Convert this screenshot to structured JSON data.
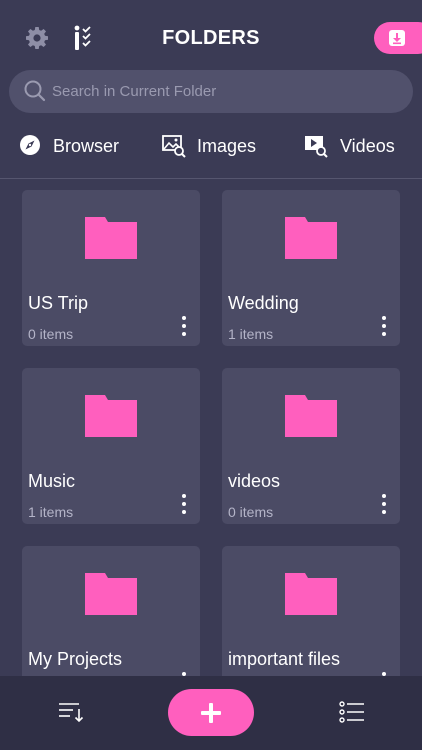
{
  "header": {
    "title": "FOLDERS",
    "settings_icon": "gear-icon",
    "tasks_icon": "task-list-icon",
    "download_icon": "download-icon"
  },
  "search": {
    "placeholder": "Search in Current Folder",
    "value": ""
  },
  "tabs": [
    {
      "label": "Browser",
      "icon": "compass-icon"
    },
    {
      "label": "Images",
      "icon": "image-search-icon"
    },
    {
      "label": "Videos",
      "icon": "video-search-icon"
    }
  ],
  "folders": [
    {
      "name": "US Trip",
      "count": "0 items"
    },
    {
      "name": "Wedding",
      "count": "1 items"
    },
    {
      "name": "Music",
      "count": "1 items"
    },
    {
      "name": "videos",
      "count": "0 items"
    },
    {
      "name": "My Projects",
      "count": ""
    },
    {
      "name": "important files",
      "count": ""
    }
  ],
  "bottom_bar": {
    "sort_icon": "sort-icon",
    "add_icon": "plus-icon",
    "list_icon": "list-view-icon"
  },
  "colors": {
    "background": "#3b3b55",
    "card": "#4b4b65",
    "accent": "#ff5fbe",
    "bottom_bar": "#2f2f45"
  }
}
